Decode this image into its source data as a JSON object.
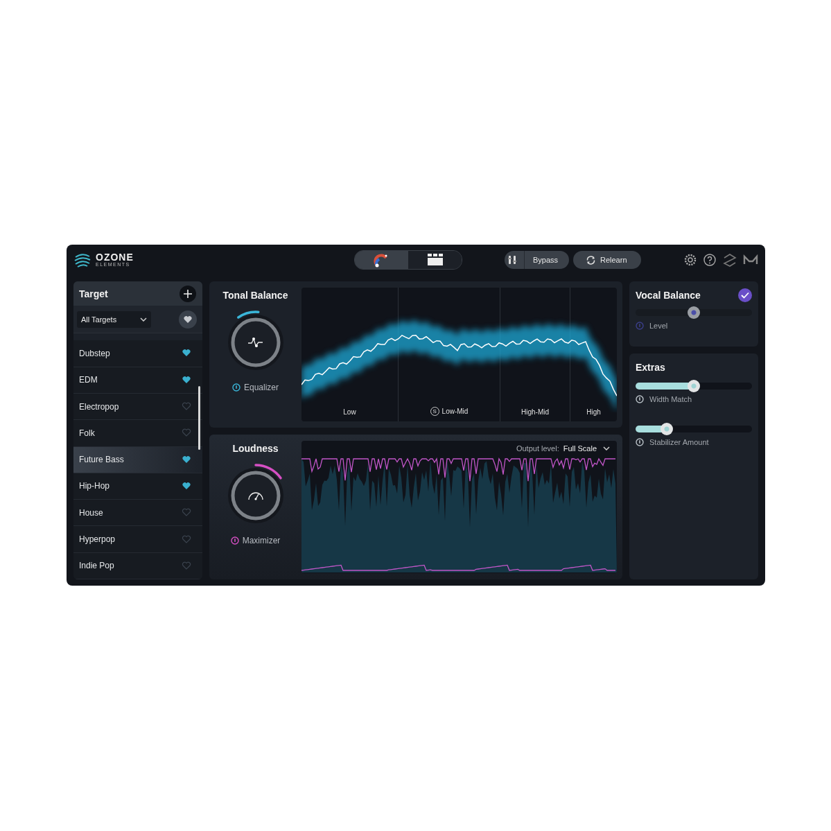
{
  "header": {
    "logo": {
      "name": "OZONE",
      "subtitle": "ELEMENTS"
    },
    "view_tabs": [
      {
        "kind": "assistant",
        "selected": true
      },
      {
        "kind": "modules",
        "selected": false
      }
    ],
    "buttons": [
      {
        "kind": "bypass",
        "label": "Bypass"
      },
      {
        "kind": "relearn",
        "label": "Relearn"
      }
    ]
  },
  "target": {
    "title": "Target",
    "filter": {
      "value": "All Targets"
    },
    "items": [
      {
        "name": "Dubstep",
        "favorite": true,
        "selected": false
      },
      {
        "name": "EDM",
        "favorite": true,
        "selected": false
      },
      {
        "name": "Electropop",
        "favorite": false,
        "selected": false
      },
      {
        "name": "Folk",
        "favorite": false,
        "selected": false
      },
      {
        "name": "Future Bass",
        "favorite": true,
        "selected": true
      },
      {
        "name": "Hip-Hop",
        "favorite": true,
        "selected": false
      },
      {
        "name": "House",
        "favorite": false,
        "selected": false
      },
      {
        "name": "Hyperpop",
        "favorite": false,
        "selected": false
      },
      {
        "name": "Indie Pop",
        "favorite": false,
        "selected": false
      }
    ]
  },
  "tonal_balance": {
    "title": "Tonal Balance",
    "knob": {
      "label": "Equalizer"
    },
    "bands": [
      {
        "label": "Low",
        "solo": false
      },
      {
        "label": "Low-Mid",
        "solo": true,
        "solo_label": "S"
      },
      {
        "label": "High-Mid",
        "solo": false
      },
      {
        "label": "High",
        "solo": false
      }
    ]
  },
  "loudness": {
    "title": "Loudness",
    "knob": {
      "label": "Maximizer"
    },
    "output_label": "Output level:",
    "output_value": "Full Scale"
  },
  "vocal_balance": {
    "title": "Vocal Balance",
    "checked": true,
    "slider": {
      "label": "Level",
      "level": 0.5
    }
  },
  "extras": {
    "title": "Extras",
    "sliders": [
      {
        "label": "Width Match",
        "level": 0.5
      },
      {
        "label": "Stabilizer Amount",
        "level": 0.27
      }
    ]
  }
}
